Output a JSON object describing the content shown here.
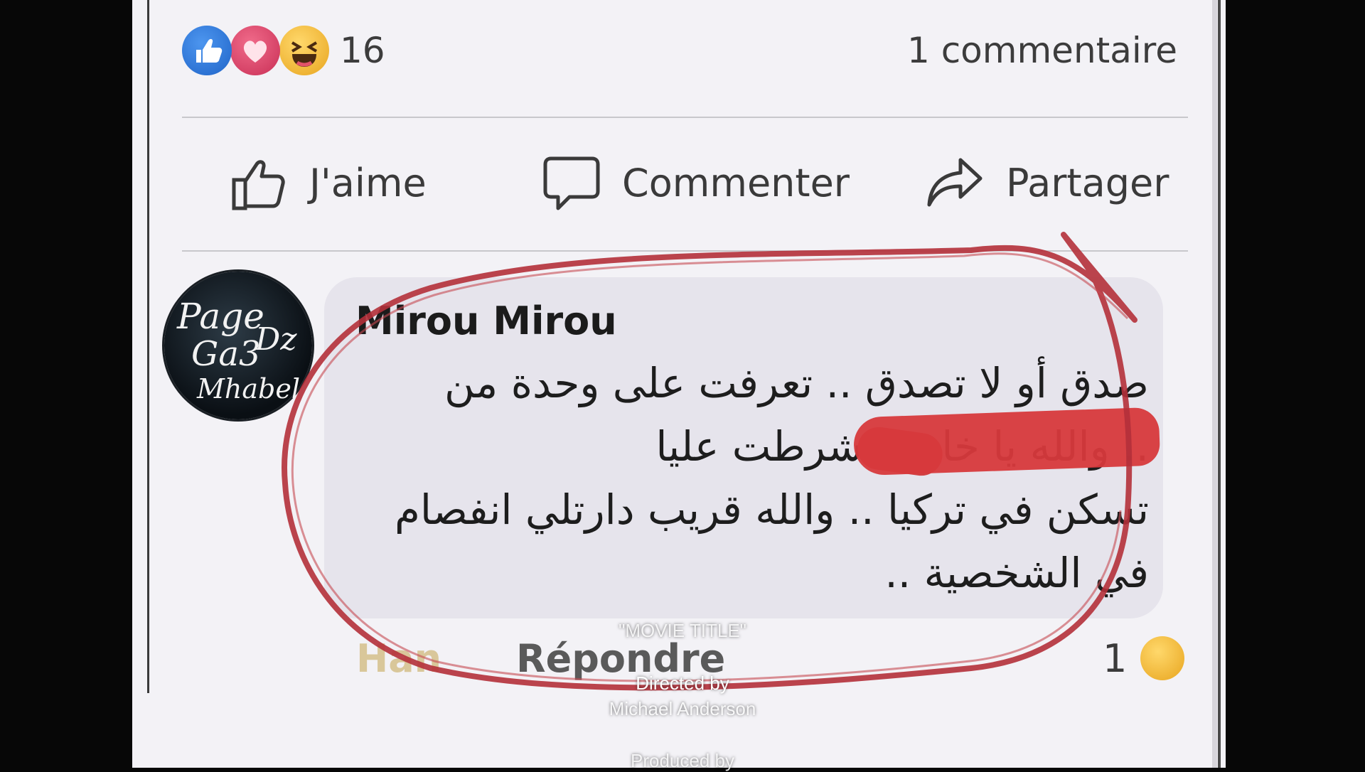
{
  "reactions": {
    "icons": [
      "like-icon",
      "love-icon",
      "haha-icon"
    ],
    "count": "16",
    "comments_label": "1 commentaire"
  },
  "actions": {
    "like_label": "J'aime",
    "comment_label": "Commenter",
    "share_label": "Partager"
  },
  "comment": {
    "avatar_text": [
      "Page",
      "Dz",
      "Ga3",
      "Mhabel"
    ],
    "author": "Mirou Mirou",
    "lines": [
      "صدق أو لا تصدق .. تعرفت على وحدة من",
      ".. والله يا خاوتي شرطت عليا",
      "تسكن في تركيا .. والله قريب دارتلي انفصام",
      "في الشخصية .."
    ],
    "footer_like": "Han",
    "footer_reply": "Répondre",
    "footer_reaction_count": "1",
    "highlight_color": "#b4303a",
    "redaction_color": "#d7393c"
  },
  "credits": {
    "title": "\"MOVIE TITLE\"",
    "directed_by": "Directed by",
    "director": "Michael Anderson",
    "produced_by": "Produced by"
  }
}
